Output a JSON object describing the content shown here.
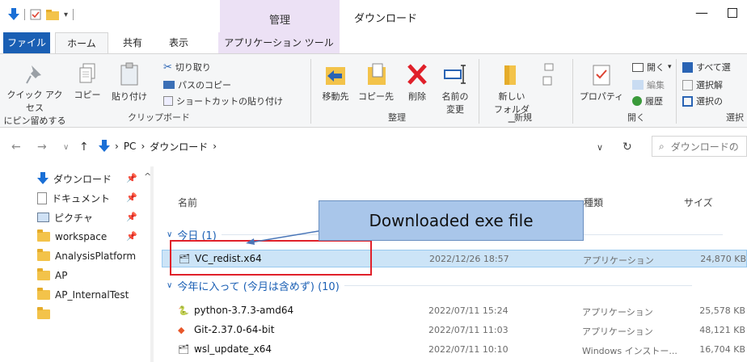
{
  "titlebar": {
    "kanri": "管理",
    "title": "ダウンロード"
  },
  "tabs": {
    "file": "ファイル",
    "home": "ホーム",
    "share": "共有",
    "view": "表示",
    "apptool": "アプリケーション ツール"
  },
  "ribbon": {
    "pin": "クイック アクセス\nにピン留めする",
    "pin_l1": "クイック アクセス",
    "pin_l2": "にピン留めする",
    "copy": "コピー",
    "paste": "貼り付け",
    "cut": "切り取り",
    "copypath": "パスのコピー",
    "pasteshortcut": "ショートカットの貼り付け",
    "clipboard": "クリップボード",
    "moveto": "移動先",
    "copyto": "コピー先",
    "delete": "削除",
    "rename_l1": "名前の",
    "rename_l2": "変更",
    "organize": "整理",
    "newfolder_l1": "新しい",
    "newfolder_l2": "フォルダー",
    "new": "新規",
    "properties": "プロパティ",
    "open": "開く",
    "edit": "編集",
    "history": "履歴",
    "open_group": "開く",
    "selectall": "すべて選",
    "selectnone": "選択解",
    "invert": "選択の",
    "select_group": "選択"
  },
  "address": {
    "pc": "PC",
    "folder": "ダウンロード",
    "search_placeholder": "ダウンロードの"
  },
  "nav": {
    "items": [
      {
        "label": "ダウンロード"
      },
      {
        "label": "ドキュメント"
      },
      {
        "label": "ピクチャ"
      },
      {
        "label": "workspace"
      },
      {
        "label": "AnalysisPlatform"
      },
      {
        "label": "AP"
      },
      {
        "label": "AP_InternalTest"
      }
    ]
  },
  "list": {
    "col_name": "名前",
    "col_kind": "種類",
    "col_size": "サイズ",
    "group_today": "今日 (1)",
    "group_year": "今年に入って (今月は含めず) (10)",
    "rows": [
      {
        "name": "VC_redist.x64",
        "date": "2022/12/26 18:57",
        "kind": "アプリケーション",
        "size": "24,870 KB"
      },
      {
        "name": "python-3.7.3-amd64",
        "date": "2022/07/11 15:24",
        "kind": "アプリケーション",
        "size": "25,578 KB"
      },
      {
        "name": "Git-2.37.0-64-bit",
        "date": "2022/07/11 11:03",
        "kind": "アプリケーション",
        "size": "48,121 KB"
      },
      {
        "name": "wsl_update_x64",
        "date": "2022/07/11 10:10",
        "kind": "Windows インストー...",
        "size": "16,704 KB"
      }
    ]
  },
  "annotation": {
    "callout": "Downloaded exe file"
  },
  "colors": {
    "accent": "#1a5fb4",
    "highlight": "#e0202a",
    "callout_bg": "#a9c6ea"
  }
}
